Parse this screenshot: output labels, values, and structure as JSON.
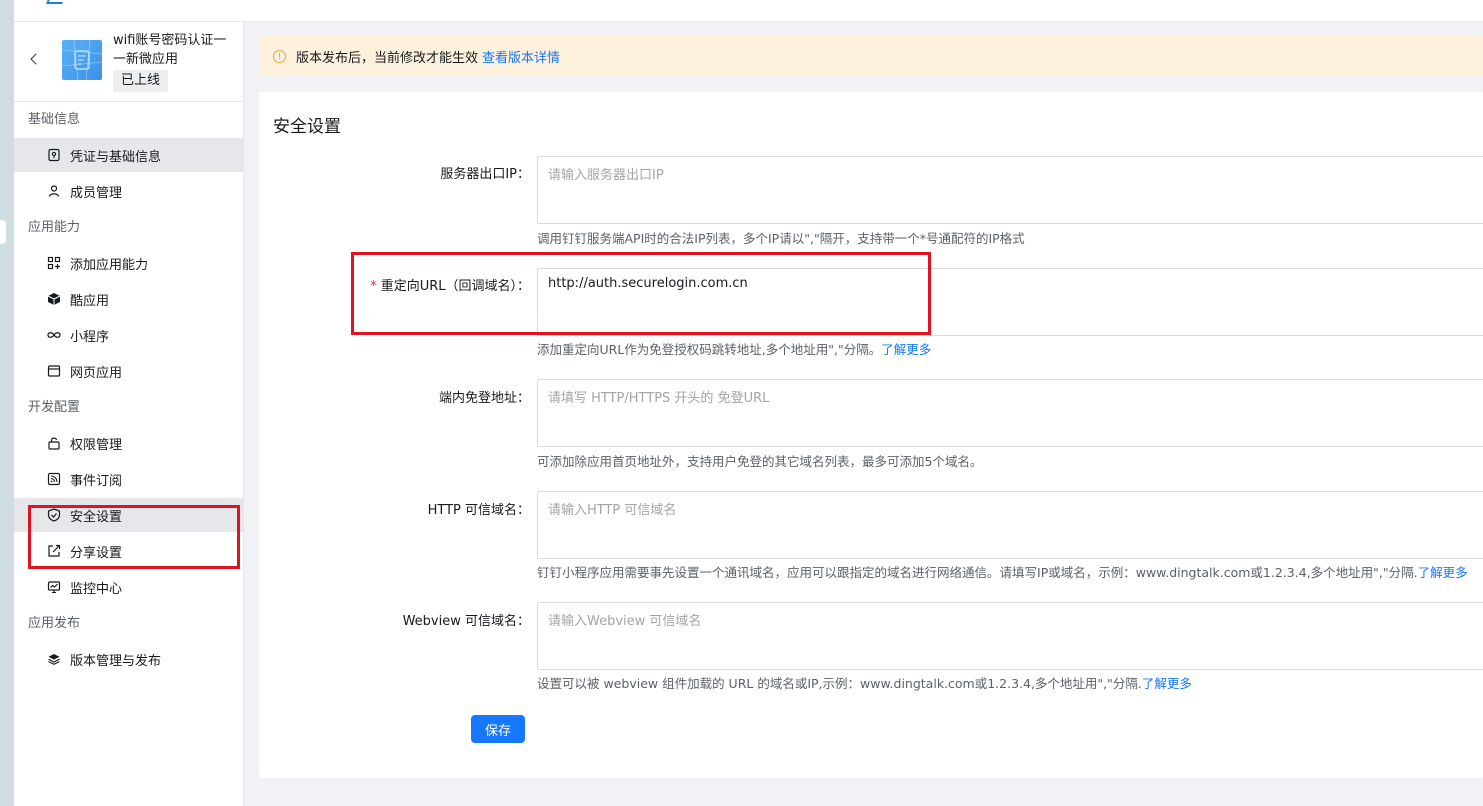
{
  "app": {
    "name": "wifi账号密码认证一一新微应用",
    "status": "已上线"
  },
  "sidebar": {
    "groups": [
      {
        "label": "基础信息",
        "items": [
          {
            "label": "凭证与基础信息",
            "icon": "credential-icon",
            "active": true
          },
          {
            "label": "成员管理",
            "icon": "user-icon"
          }
        ]
      },
      {
        "label": "应用能力",
        "items": [
          {
            "label": "添加应用能力",
            "icon": "grid-plus-icon"
          },
          {
            "label": "酷应用",
            "icon": "cube-icon"
          },
          {
            "label": "小程序",
            "icon": "infinity-icon"
          },
          {
            "label": "网页应用",
            "icon": "browser-icon"
          }
        ]
      },
      {
        "label": "开发配置",
        "items": [
          {
            "label": "权限管理",
            "icon": "lock-icon"
          },
          {
            "label": "事件订阅",
            "icon": "rss-icon"
          },
          {
            "label": "安全设置",
            "icon": "shield-icon",
            "active": true
          },
          {
            "label": "分享设置",
            "icon": "share-edit-icon"
          },
          {
            "label": "监控中心",
            "icon": "monitor-icon"
          }
        ]
      },
      {
        "label": "应用发布",
        "items": [
          {
            "label": "版本管理与发布",
            "icon": "layers-icon"
          }
        ]
      }
    ]
  },
  "notice": {
    "text": "版本发布后，当前修改才能生效",
    "link": "查看版本详情",
    "icon": "warning-icon",
    "color": "#fdf1de"
  },
  "security": {
    "title": "安全设置",
    "fields": [
      {
        "label": "服务器出口IP：",
        "placeholder": "请输入服务器出口IP",
        "value": "",
        "help": "调用钉钉服务端API时的合法IP列表，多个IP请以\",\"隔开，支持带一个*号通配符的IP格式",
        "help_link": ""
      },
      {
        "label": "重定向URL（回调域名）：",
        "required": "*",
        "placeholder": "",
        "value": "http://auth.securelogin.com.cn",
        "help": "添加重定向URL作为免登授权码跳转地址,多个地址用\",\"分隔。",
        "help_link": "了解更多"
      },
      {
        "label": "端内免登地址：",
        "placeholder": "请填写 HTTP/HTTPS 开头的 免登URL",
        "value": "",
        "help": "可添加除应用首页地址外，支持用户免登的其它域名列表，最多可添加5个域名。",
        "help_link": ""
      },
      {
        "label": "HTTP 可信域名：",
        "placeholder": "请输入HTTP 可信域名",
        "value": "",
        "help": "钉钉小程序应用需要事先设置一个通讯域名，应用可以跟指定的域名进行网络通信。请填写IP或域名，示例：www.dingtalk.com或1.2.3.4,多个地址用\",\"分隔.",
        "help_link": "了解更多"
      },
      {
        "label": "Webview 可信域名：",
        "placeholder": "请输入Webview 可信域名",
        "value": "",
        "help": "设置可以被 webview 组件加载的 URL 的域名或IP,示例：www.dingtalk.com或1.2.3.4,多个地址用\",\"分隔.",
        "help_link": "了解更多"
      }
    ],
    "save_label": "保存"
  },
  "colors": {
    "primary": "#1677ff",
    "highlight": "#e0141e",
    "warning": "#f2a33a"
  }
}
